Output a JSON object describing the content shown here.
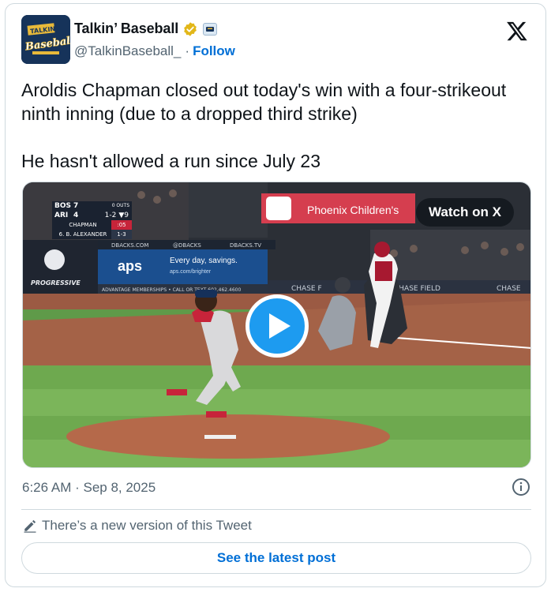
{
  "author": {
    "display_name": "Talkin’ Baseball",
    "handle": "@TalkinBaseball_",
    "separator": "·",
    "follow_label": "Follow",
    "avatar_text_top": "TALKIN'",
    "avatar_text_main": "Baseball"
  },
  "tweet": {
    "text": "Aroldis Chapman closed out today's win with a four-strikeout ninth inning (due to a dropped third strike)\n\nHe hasn't allowed a run since July 23",
    "timestamp": "6:26 AM · Sep 8, 2025"
  },
  "media": {
    "watch_label": "Watch on X",
    "scoreboard": {
      "away_team": "BOS",
      "away_score": "7",
      "home_team": "ARI",
      "home_score": "4",
      "outs": "0 OUTS",
      "count": "1-2",
      "inning": "▼9",
      "pitcher": "CHAPMAN",
      "pitch_clock": ":05",
      "batter": "6. B. ALEXANDER",
      "batter_line": "1-3"
    },
    "signage": {
      "phoenix": "Phoenix Children's",
      "aps_logo": "aps",
      "aps_tagline": "Every day, savings.",
      "aps_url": "aps.com/brighter",
      "dbacks": "DBACKS.COM",
      "at_dbacks": "@DBACKS",
      "dbacks_tv": "DBACKS.TV",
      "progressive": "PROGRESSIVE",
      "advantage": "ADVANTAGE MEMBERSHIPS • CALL OR TEXT 602.462.4600",
      "chase_left": "CHASE F",
      "chase_right": "CHASE FIELD",
      "chase_far": "CHASE"
    }
  },
  "footer": {
    "new_version": "There’s a new version of this Tweet",
    "latest_button": "See the latest post"
  },
  "colors": {
    "link_blue": "#006fd6",
    "play_blue": "#1d9bf0",
    "muted": "#536471",
    "border": "#cfd9de"
  }
}
